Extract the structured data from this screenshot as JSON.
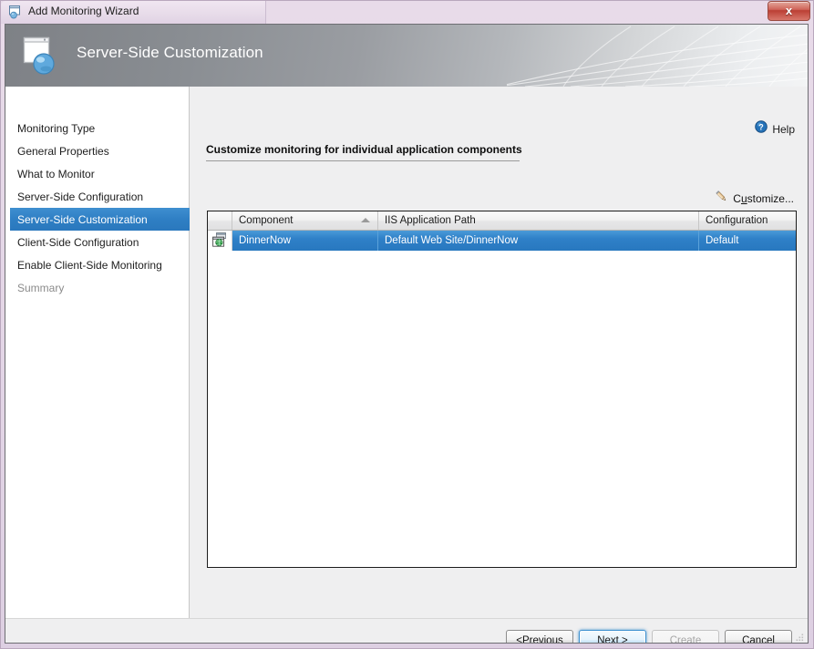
{
  "window": {
    "title": "Add Monitoring Wizard",
    "title_icon": "wizard-window-icon",
    "close_label": "x"
  },
  "banner": {
    "title": "Server-Side Customization",
    "icon": "server-sphere-icon"
  },
  "sidebar": {
    "items": [
      {
        "label": "Monitoring Type",
        "state": "normal"
      },
      {
        "label": "General Properties",
        "state": "normal"
      },
      {
        "label": "What to Monitor",
        "state": "normal"
      },
      {
        "label": "Server-Side Configuration",
        "state": "normal"
      },
      {
        "label": "Server-Side Customization",
        "state": "selected"
      },
      {
        "label": "Client-Side Configuration",
        "state": "normal"
      },
      {
        "label": "Enable Client-Side Monitoring",
        "state": "normal"
      },
      {
        "label": "Summary",
        "state": "disabled"
      }
    ]
  },
  "content": {
    "help": {
      "label": "Help",
      "icon": "help-question-icon"
    },
    "heading": "Customize monitoring for individual application components",
    "customize": {
      "label_pre": "C",
      "label_accel": "u",
      "label_post": "stomize...",
      "icon": "pencil-icon"
    },
    "grid": {
      "columns": [
        {
          "key": "icon",
          "label": ""
        },
        {
          "key": "component",
          "label": "Component",
          "sort": "ascending"
        },
        {
          "key": "path",
          "label": "IIS Application Path",
          "sort": "none"
        },
        {
          "key": "configuration",
          "label": "Configuration",
          "sort": "none"
        }
      ],
      "rows": [
        {
          "icon": "web-application-icon",
          "component": "DinnerNow",
          "path": "Default Web Site/DinnerNow",
          "configuration": "Default",
          "selected": true
        }
      ]
    }
  },
  "footer": {
    "buttons": [
      {
        "name": "previous",
        "pre": "< ",
        "accel": "P",
        "post": "revious",
        "state": "normal"
      },
      {
        "name": "next",
        "pre": "",
        "accel": "N",
        "post": "ext >",
        "state": "default"
      },
      {
        "name": "create",
        "pre": "C",
        "accel": "r",
        "post": "eate",
        "state": "disabled"
      },
      {
        "name": "cancel",
        "pre": "",
        "accel": "C",
        "post": "ancel",
        "state": "normal"
      }
    ]
  },
  "colors": {
    "titlebar": "#e3d5e6",
    "selection_blue": "#2f80c8",
    "banner_gray": "#8a8e93",
    "close_red": "#bb3f34",
    "disabled_gray": "#8b8b8b"
  }
}
